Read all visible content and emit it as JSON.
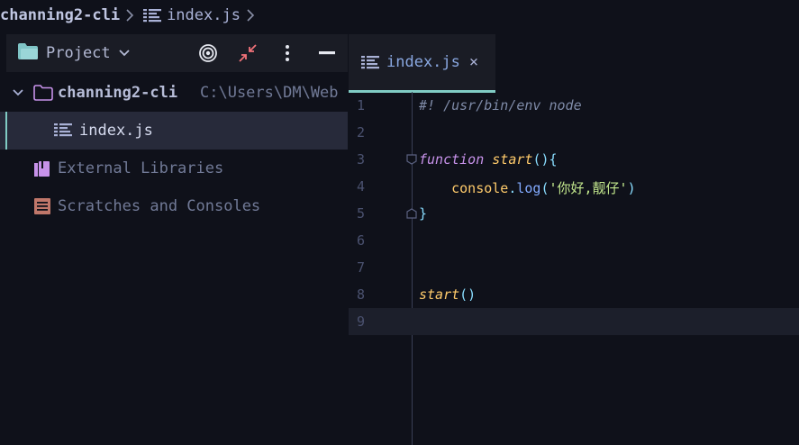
{
  "breadcrumb": {
    "project": "channing2-cli",
    "file": "index.js"
  },
  "project_panel": {
    "title": "Project",
    "tools": [
      "target-icon",
      "collapse-icon",
      "more-icon",
      "minimize-icon"
    ],
    "tree": {
      "root_name": "channing2-cli",
      "root_path": "C:\\Users\\DM\\Web",
      "file": "index.js",
      "external_libraries": "External Libraries",
      "scratches": "Scratches and Consoles"
    }
  },
  "editor": {
    "tab_label": "index.js",
    "tab_close": "×",
    "lines": [
      {
        "n": "1",
        "tokens": [
          {
            "t": "#! /usr/bin/env node",
            "c": "c-comment"
          }
        ]
      },
      {
        "n": "2",
        "tokens": []
      },
      {
        "n": "3",
        "tokens": [
          {
            "t": "function",
            "c": "c-kw"
          },
          {
            "t": " ",
            "c": "c-plain"
          },
          {
            "t": "start",
            "c": "c-fn"
          },
          {
            "t": "(){",
            "c": "c-paren"
          }
        ]
      },
      {
        "n": "4",
        "tokens": [
          {
            "t": "    ",
            "c": "c-plain"
          },
          {
            "t": "console",
            "c": "c-obj"
          },
          {
            "t": ".",
            "c": "c-paren"
          },
          {
            "t": "log",
            "c": "c-method"
          },
          {
            "t": "(",
            "c": "c-paren"
          },
          {
            "t": "'你好,靓仔'",
            "c": "c-str"
          },
          {
            "t": ")",
            "c": "c-paren"
          }
        ]
      },
      {
        "n": "5",
        "tokens": [
          {
            "t": "}",
            "c": "c-paren"
          }
        ]
      },
      {
        "n": "6",
        "tokens": []
      },
      {
        "n": "7",
        "tokens": []
      },
      {
        "n": "8",
        "tokens": [
          {
            "t": "start",
            "c": "c-fn"
          },
          {
            "t": "()",
            "c": "c-paren"
          }
        ]
      },
      {
        "n": "9",
        "tokens": []
      }
    ]
  },
  "colors": {
    "background": "#0f111a",
    "panel_header": "#1a1c25",
    "selection": "#272a3a",
    "accent": "#80cbc4"
  }
}
